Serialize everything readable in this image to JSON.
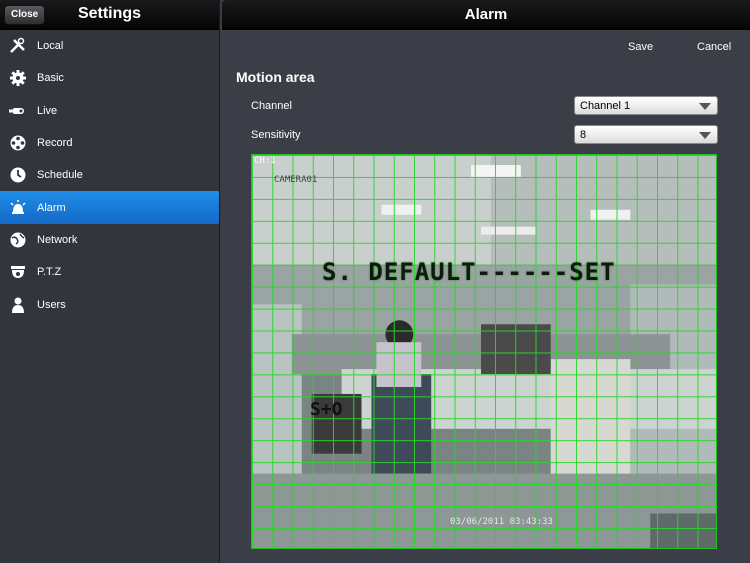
{
  "sidebar": {
    "title": "Settings",
    "close_label": "Close",
    "items": [
      {
        "label": "Local",
        "icon": "tools-icon"
      },
      {
        "label": "Basic",
        "icon": "gear-icon"
      },
      {
        "label": "Live",
        "icon": "camera-icon"
      },
      {
        "label": "Record",
        "icon": "film-reel-icon"
      },
      {
        "label": "Schedule",
        "icon": "clock-icon"
      },
      {
        "label": "Alarm",
        "icon": "alarm-bell-icon",
        "active": true
      },
      {
        "label": "Network",
        "icon": "globe-icon"
      },
      {
        "label": "P.T.Z",
        "icon": "dome-camera-icon"
      },
      {
        "label": "Users",
        "icon": "user-icon"
      }
    ]
  },
  "main": {
    "title": "Alarm",
    "save_label": "Save",
    "cancel_label": "Cancel",
    "section_title": "Motion area",
    "channel": {
      "label": "Channel",
      "value": "Channel 1"
    },
    "sensitivity": {
      "label": "Sensitivity",
      "value": "8"
    },
    "video": {
      "ch_label": "CH:1",
      "camera_label": "CAMERA01",
      "overlay_text": "S. DEFAULT------SET",
      "overlay_text2": "S+O",
      "timestamp": "03/06/2011 03:43:33"
    }
  },
  "colors": {
    "accent": "#1a7fdc",
    "grid": "#2ad62a"
  }
}
